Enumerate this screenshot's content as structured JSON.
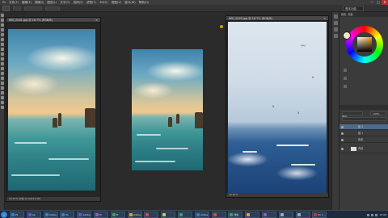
{
  "app": {
    "menus": [
      "Ps",
      "文件(F)",
      "编辑(E)",
      "图像(I)",
      "图层(L)",
      "文字(Y)",
      "选择(S)",
      "滤镜(T)",
      "3D(D)",
      "视图(V)",
      "窗口(W)",
      "帮助(H)"
    ],
    "window_controls": [
      "—",
      "□",
      "✕"
    ],
    "workspace": "基本功能"
  },
  "documents": [
    {
      "title": "IMG_0001.jpg @ 16.7% (RGB/8)",
      "status": "16.67%   文档:12.0M/12.0M"
    },
    {
      "title": "IMG_0002.jpg @ 16.7% (RGB/8)",
      "status": ""
    },
    {
      "title": "IMG_0003.jpg @ 16.7% (RGB/8)",
      "status": "16.67%"
    }
  ],
  "panels": {
    "tabs": [
      "颜色",
      "色板"
    ],
    "layers_tab": "图层",
    "opacity_label": "100%",
    "layers": [
      {
        "name": "组 2",
        "selected": true
      },
      {
        "name": "组 1",
        "selected": false
      },
      {
        "name": "色彩",
        "selected": false
      },
      {
        "name": "背景",
        "selected": false
      }
    ]
  },
  "taskbar": {
    "tasks": [
      "Ps",
      "Ae",
      "Adobe Ps...",
      "Ps",
      "Adobe Pr...",
      "Pr",
      "Pr",
      "Adobe...",
      "",
      "",
      "",
      "Adobe P...",
      "",
      "微信",
      "",
      "",
      "",
      "",
      "Ps 1 ..."
    ],
    "task_colors": [
      "#2f7fd8",
      "#7a4cc8",
      "#2f7fd8",
      "#2f7fd8",
      "#7a4cc8",
      "#9b59b6",
      "#3fa34d",
      "#e8a020",
      "#d84a2f",
      "#e0c040",
      "#3fa34d",
      "#2f7fd8",
      "#d84a2f",
      "#3fa34d",
      "#e8a020",
      "#9b59b6",
      "#aaaaaa",
      "#aaaaaa",
      "#c0392b"
    ],
    "clock": "15:08"
  }
}
